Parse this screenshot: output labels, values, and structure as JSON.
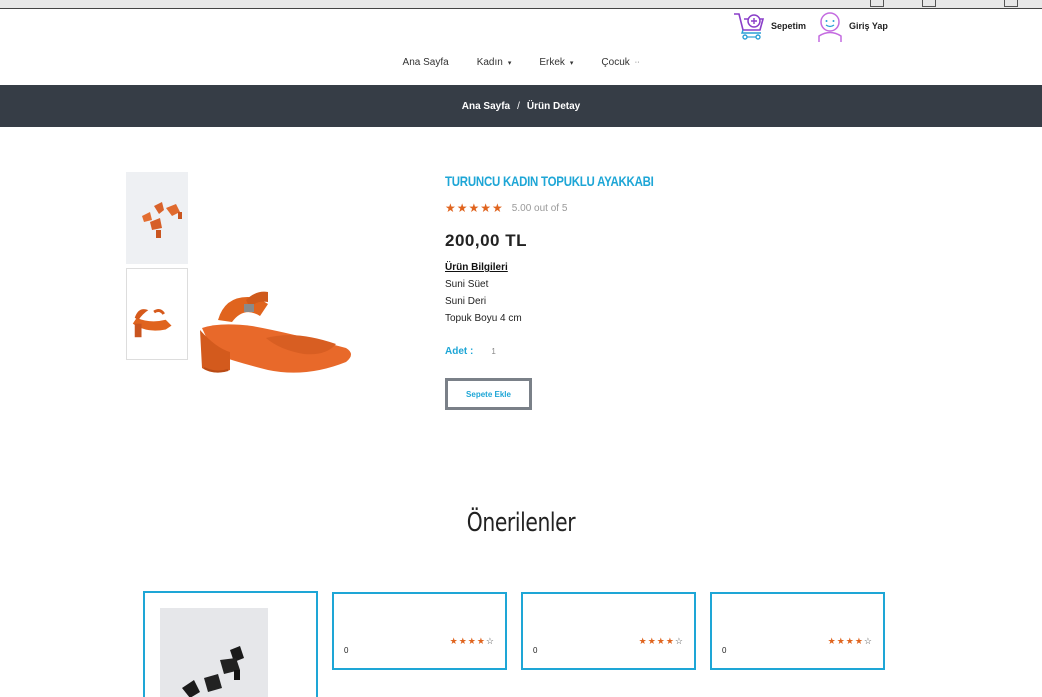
{
  "header": {
    "cart_label": "Sepetim",
    "login_label": "Giriş Yap"
  },
  "nav": {
    "items": [
      {
        "label": "Ana Sayfa",
        "caret": ""
      },
      {
        "label": "Kadın",
        "caret": "▾"
      },
      {
        "label": "Erkek",
        "caret": "▾"
      },
      {
        "label": "Çocuk",
        "caret": "··"
      }
    ]
  },
  "breadcrumb": {
    "home": "Ana Sayfa",
    "separator": "/",
    "current": "Ürün Detay"
  },
  "product": {
    "title": "TURUNCU KADIN TOPUKLU AYAKKABI",
    "stars": "★★★★★",
    "rating_text": "5.00 out of 5",
    "price": "200,00 TL",
    "info_title": "Ürün Bilgileri",
    "info_lines": [
      "Suni Süet",
      "Suni Deri",
      "Topuk Boyu 4 cm"
    ],
    "qty_label": "Adet :",
    "qty_value": "1",
    "add_to_cart": "Sepete Ekle",
    "color": "#e0641e"
  },
  "recommended": {
    "title": "Önerilenler",
    "items": [
      {
        "price": ""
      },
      {
        "price": "0",
        "stars": "★★★★",
        "empty_star": "☆"
      },
      {
        "price": "0",
        "stars": "★★★★",
        "empty_star": "☆"
      },
      {
        "price": "0",
        "stars": "★★★★",
        "empty_star": "☆"
      }
    ]
  },
  "colors": {
    "accent": "#1ea6d6",
    "breadcrumb_bg": "#363d46",
    "star": "#e0641e"
  }
}
